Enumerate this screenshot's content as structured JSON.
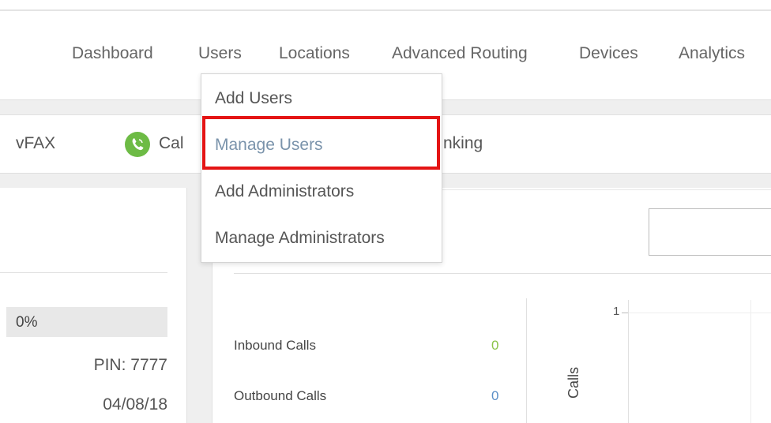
{
  "nav": {
    "items": [
      "Dashboard",
      "Users",
      "Locations",
      "Advanced Routing",
      "Devices",
      "Analytics"
    ]
  },
  "subnav": {
    "vfax_label": "vFAX",
    "call_label_partial": "Cal",
    "partial_after_dropdown": "nking",
    "phone_icon_color": "#6dbb45"
  },
  "dropdown": {
    "items": [
      {
        "label": "Add Users",
        "active": false
      },
      {
        "label": "Manage Users",
        "active": true
      },
      {
        "label": "Add Administrators",
        "active": false
      },
      {
        "label": "Manage Administrators",
        "active": false
      }
    ],
    "highlight_color": "#e41414"
  },
  "left_panel": {
    "percent": "0%",
    "pin": "PIN: 7777",
    "date": "04/08/18"
  },
  "stats": {
    "inbound_label": "Inbound Calls",
    "inbound_value": "0",
    "inbound_color": "#8bc34a",
    "outbound_label": "Outbound Calls",
    "outbound_value": "0",
    "outbound_color": "#5b8fc7"
  },
  "chart": {
    "y_tick": "1",
    "y_axis_label": "Calls"
  }
}
